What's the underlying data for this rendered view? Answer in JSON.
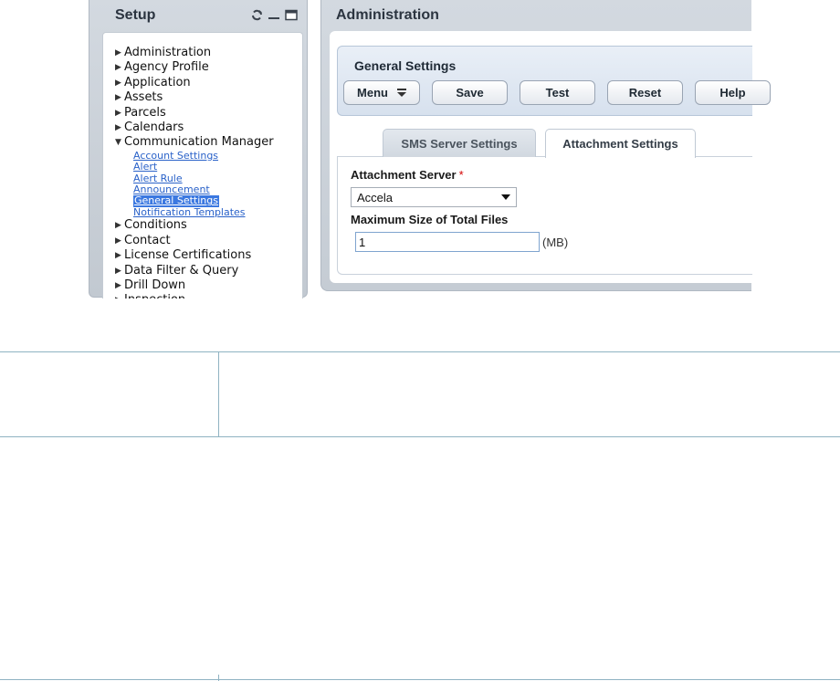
{
  "setup": {
    "title": "Setup",
    "controls": [
      "refresh-icon",
      "minimize-icon",
      "maximize-icon"
    ],
    "tree": [
      {
        "label": "Administration",
        "expanded": false
      },
      {
        "label": "Agency Profile",
        "expanded": false
      },
      {
        "label": "Application",
        "expanded": false
      },
      {
        "label": "Assets",
        "expanded": false
      },
      {
        "label": "Parcels",
        "expanded": false
      },
      {
        "label": "Calendars",
        "expanded": false
      },
      {
        "label": "Communication Manager",
        "expanded": true,
        "children": [
          "Account Settings",
          "Alert",
          "Alert Rule",
          "Announcement",
          "General Settings",
          "Notification Templates"
        ],
        "selected": "General Settings"
      },
      {
        "label": "Conditions",
        "expanded": false
      },
      {
        "label": "Contact",
        "expanded": false
      },
      {
        "label": "License Certifications",
        "expanded": false
      },
      {
        "label": "Data Filter & Query",
        "expanded": false
      },
      {
        "label": "Drill Down",
        "expanded": false
      },
      {
        "label": "Inspection",
        "expanded": false
      }
    ]
  },
  "admin": {
    "title": "Administration",
    "section_title": "General Settings",
    "buttons": {
      "menu": "Menu",
      "save": "Save",
      "test": "Test",
      "reset": "Reset",
      "help": "Help"
    },
    "tabs": [
      {
        "label": "SMS Server Settings",
        "active": false
      },
      {
        "label": "Attachment Settings",
        "active": true
      }
    ],
    "form": {
      "attachment_server_label": "Attachment Server",
      "required_marker": "*",
      "attachment_server_value": "Accela",
      "max_size_label": "Maximum Size of Total Files",
      "max_size_value": "1",
      "max_size_unit": "(MB)"
    }
  },
  "colors": {
    "accent": "#3b78e0",
    "panel": "#c9d0d8",
    "required": "#d40000",
    "table_line": "#8fb3c2"
  }
}
